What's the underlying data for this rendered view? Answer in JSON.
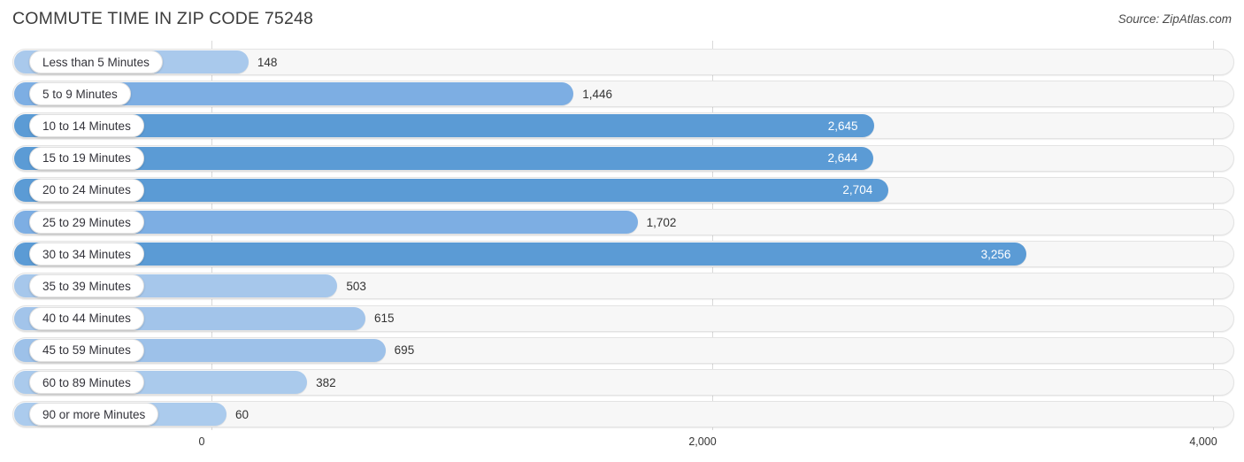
{
  "header": {
    "title": "COMMUTE TIME IN ZIP CODE 75248",
    "source": "Source: ZipAtlas.com"
  },
  "chart_data": {
    "type": "bar",
    "orientation": "horizontal",
    "title": "COMMUTE TIME IN ZIP CODE 75248",
    "xlabel": "",
    "ylabel": "",
    "xlim": [
      0,
      4000
    ],
    "grid": true,
    "legend": "none",
    "tick_labels": [
      "0",
      "2,000",
      "4,000"
    ],
    "ticks": [
      0,
      2000,
      4000
    ],
    "categories": [
      "Less than 5 Minutes",
      "5 to 9 Minutes",
      "10 to 14 Minutes",
      "15 to 19 Minutes",
      "20 to 24 Minutes",
      "25 to 29 Minutes",
      "30 to 34 Minutes",
      "35 to 39 Minutes",
      "40 to 44 Minutes",
      "45 to 59 Minutes",
      "60 to 89 Minutes",
      "90 or more Minutes"
    ],
    "values": [
      148,
      1446,
      2645,
      2644,
      2704,
      1702,
      3256,
      503,
      615,
      695,
      382,
      60
    ],
    "value_labels": [
      "148",
      "1,446",
      "2,645",
      "2,644",
      "2,704",
      "1,702",
      "3,256",
      "503",
      "615",
      "695",
      "382",
      "60"
    ],
    "bar_colors": [
      "#a9c9ec",
      "#7daee3",
      "#5b9bd5",
      "#5b9bd5",
      "#5b9bd5",
      "#7daee3",
      "#5b9bd5",
      "#a6c7eb",
      "#a2c4ea",
      "#9dc1e9",
      "#aacaec",
      "#abcbed"
    ]
  },
  "colors": {
    "accent": "#5b9bd5",
    "track": "#f7f7f7",
    "track_border": "#e3e3e3",
    "gridline": "#d9d9d9",
    "text": "#333333"
  }
}
